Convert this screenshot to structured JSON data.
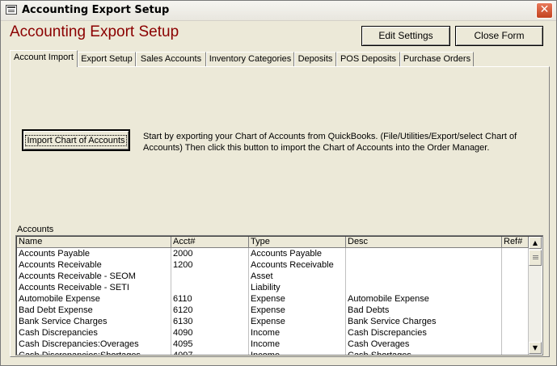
{
  "window": {
    "title": "Accounting Export Setup",
    "close_glyph": "✕"
  },
  "form": {
    "title": "Accounting Export Setup"
  },
  "toolbar": {
    "edit_label": "Edit Settings",
    "close_label": "Close Form"
  },
  "tabs": [
    {
      "label": "Account Import",
      "active": true
    },
    {
      "label": "Export Setup",
      "active": false
    },
    {
      "label": "Sales Accounts",
      "active": false
    },
    {
      "label": "Inventory Categories",
      "active": false
    },
    {
      "label": "Deposits",
      "active": false
    },
    {
      "label": "POS Deposits",
      "active": false
    },
    {
      "label": "Purchase Orders",
      "active": false
    }
  ],
  "import": {
    "button_label": "Import Chart of Accounts",
    "instructions": "Start by exporting your Chart of Accounts from QuickBooks. (File/Utilities/Export/select Chart of Accounts) Then click this button to import the Chart of Accounts into the Order Manager."
  },
  "accounts": {
    "label": "Accounts",
    "columns": [
      "Name",
      "Acct#",
      "Type",
      "Desc",
      "Ref#"
    ],
    "rows": [
      [
        "Accounts Payable",
        "2000",
        "Accounts Payable",
        "",
        ""
      ],
      [
        "Accounts Receivable",
        "1200",
        "Accounts Receivable",
        "",
        ""
      ],
      [
        "Accounts Receivable - SEOM",
        "",
        "Asset",
        "",
        ""
      ],
      [
        "Accounts Receivable - SETI",
        "",
        "Liability",
        "",
        ""
      ],
      [
        "Automobile Expense",
        "6110",
        "Expense",
        "Automobile Expense",
        ""
      ],
      [
        "Bad Debt Expense",
        "6120",
        "Expense",
        "Bad Debts",
        ""
      ],
      [
        "Bank Service Charges",
        "6130",
        "Expense",
        "Bank Service Charges",
        ""
      ],
      [
        "Cash Discrepancies",
        "4090",
        "Income",
        "Cash Discrepancies",
        ""
      ],
      [
        "Cash Discrepancies:Overages",
        "4095",
        "Income",
        "Cash Overages",
        ""
      ],
      [
        "Cash Discrepancies:Shortages",
        "4097",
        "Income",
        "Cash Shortages",
        ""
      ]
    ]
  }
}
